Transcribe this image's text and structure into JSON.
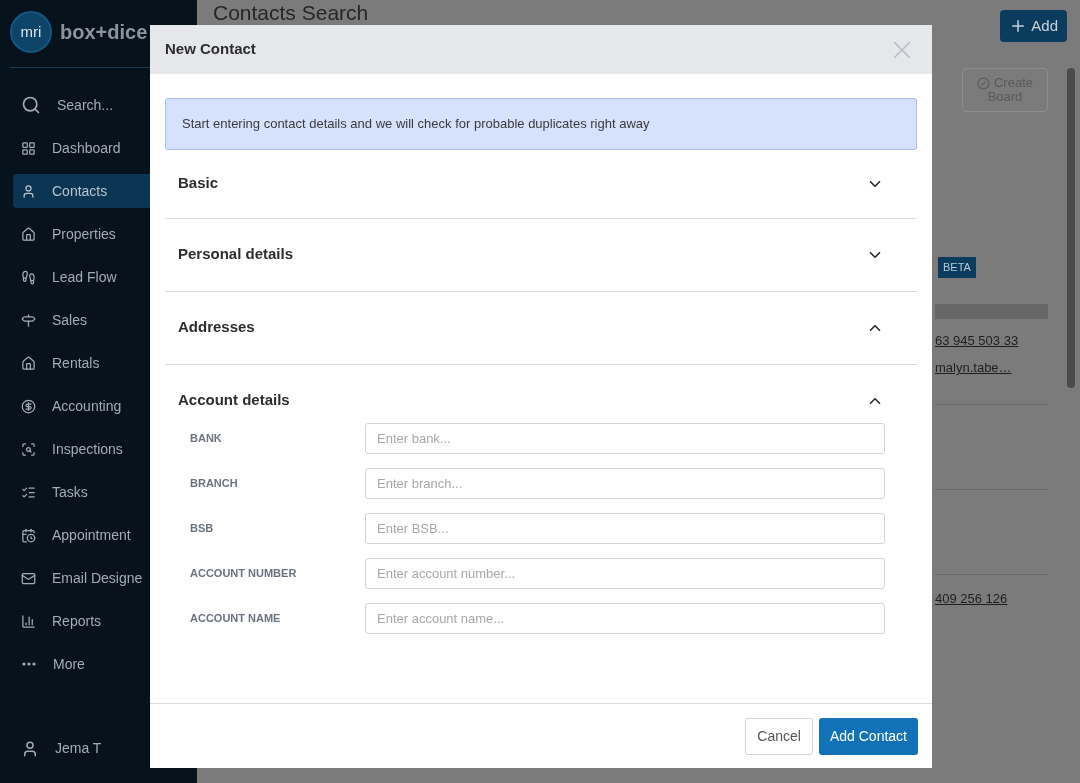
{
  "sidebar": {
    "logo_mark": "mri",
    "brand": "box+dice",
    "items": [
      {
        "label": "Search...",
        "selected": false
      },
      {
        "label": "Dashboard",
        "selected": false
      },
      {
        "label": "Contacts",
        "selected": true
      },
      {
        "label": "Properties",
        "selected": false
      },
      {
        "label": "Lead Flow",
        "selected": false
      },
      {
        "label": "Sales",
        "selected": false
      },
      {
        "label": "Rentals",
        "selected": false
      },
      {
        "label": "Accounting",
        "selected": false
      },
      {
        "label": "Inspections",
        "selected": false
      },
      {
        "label": "Tasks",
        "selected": false
      },
      {
        "label": "Appointment",
        "selected": false
      },
      {
        "label": "Email Designe",
        "selected": false
      },
      {
        "label": "Reports",
        "selected": false
      },
      {
        "label": "More",
        "selected": false
      }
    ],
    "user": "Jema T"
  },
  "page": {
    "title": "Contacts Search",
    "add_button": "Add",
    "create_board_button": "Create Board",
    "badge": "BETA",
    "phone_1": "63 945 503 33",
    "email_1": "malyn.tabe…",
    "phone_2": "409 256 126"
  },
  "dialog": {
    "title": "New Contact",
    "notice": "Start entering contact details and we will check for probable duplicates right away",
    "sections": [
      {
        "title": "Basic",
        "expanded": false
      },
      {
        "title": "Personal details",
        "expanded": false
      },
      {
        "title": "Addresses",
        "expanded": true
      },
      {
        "title": "Account details",
        "expanded": true,
        "fields": [
          {
            "label": "BANK",
            "placeholder": "Enter bank..."
          },
          {
            "label": "BRANCH",
            "placeholder": "Enter branch..."
          },
          {
            "label": "BSB",
            "placeholder": "Enter BSB..."
          },
          {
            "label": "ACCOUNT NUMBER",
            "placeholder": "Enter account number..."
          },
          {
            "label": "ACCOUNT NAME",
            "placeholder": "Enter account name..."
          }
        ]
      }
    ],
    "buttons": {
      "cancel": "Cancel",
      "submit": "Add Contact"
    }
  }
}
